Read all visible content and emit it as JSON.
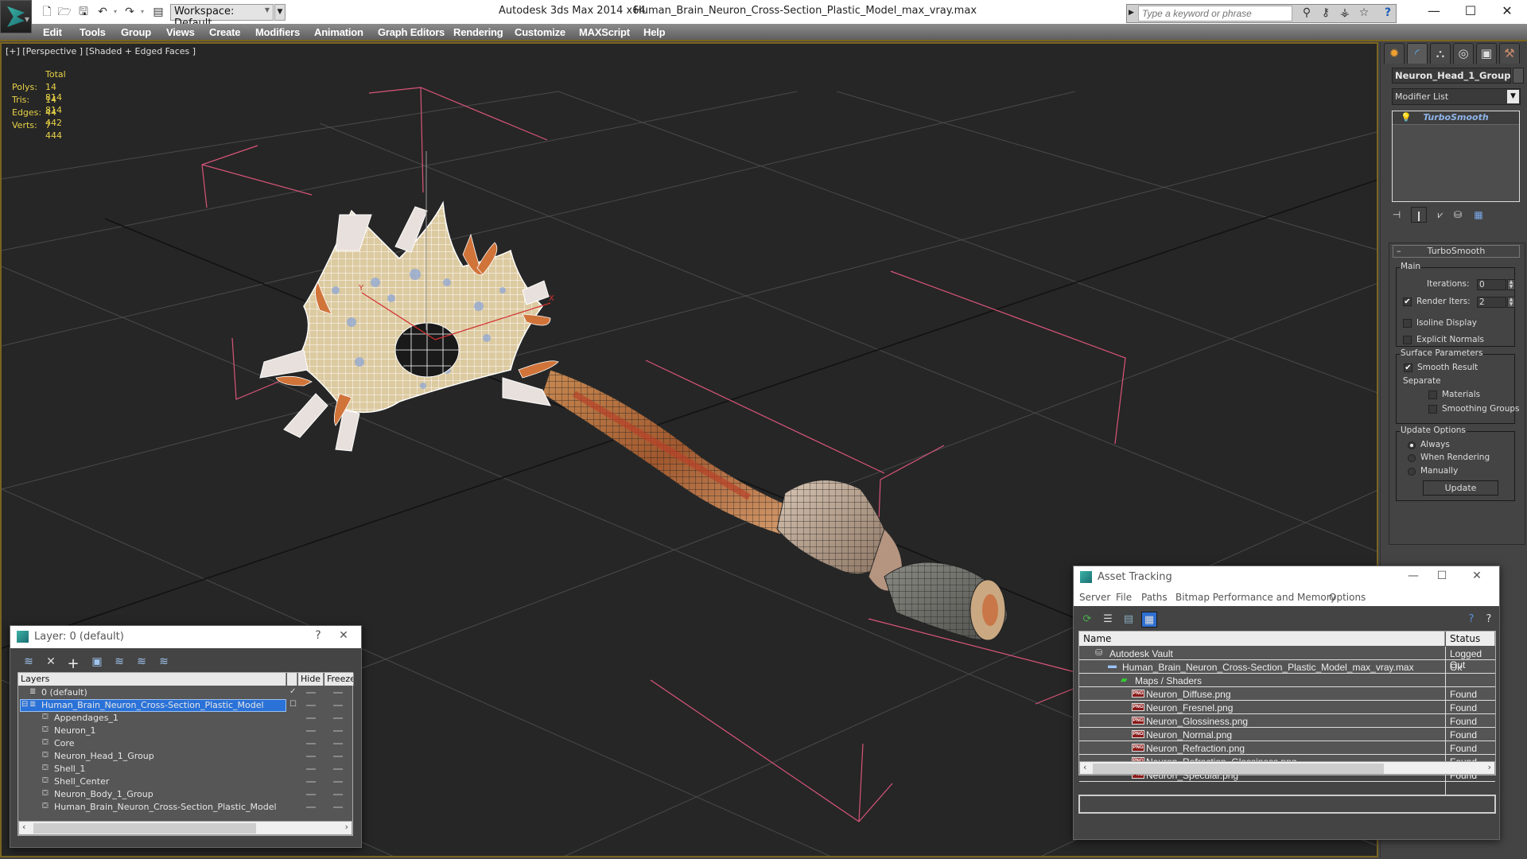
{
  "titlebar": {
    "app_title": "Autodesk 3ds Max  2014 x64",
    "file_title": "Human_Brain_Neuron_Cross-Section_Plastic_Model_max_vray.max",
    "workspace": "Workspace: Default",
    "search_placeholder": "Type a keyword or phrase",
    "quick_access": [
      "new-file",
      "open-file",
      "save-file",
      "undo",
      "redo",
      "project-folder"
    ],
    "info_icons": [
      "binoculars",
      "key",
      "satellite",
      "star",
      "help"
    ]
  },
  "menu": [
    "Edit",
    "Tools",
    "Group",
    "Views",
    "Create",
    "Modifiers",
    "Animation",
    "Graph Editors",
    "Rendering",
    "Customize",
    "MAXScript",
    "Help"
  ],
  "viewport": {
    "label": "[+] [Perspective ] [Shaded + Edged Faces ]",
    "stats": {
      "header": "Total",
      "rows": [
        {
          "label": "Polys:",
          "value": "14 814"
        },
        {
          "label": "Tris:",
          "value": "14 814"
        },
        {
          "label": "Edges:",
          "value": "44 442"
        },
        {
          "label": "Verts:",
          "value": "7 444"
        }
      ]
    },
    "axis_x_label": "X",
    "axis_y_label": "Y"
  },
  "command_panel": {
    "tabs": [
      "create",
      "modify",
      "hierarchy",
      "motion",
      "display",
      "utilities"
    ],
    "active_tab": "modify",
    "object_name": "Neuron_Head_1_Group",
    "modifier_list": "Modifier List",
    "stack": [
      "TurboSmooth"
    ],
    "rollout": {
      "title": "TurboSmooth",
      "main_group": "Main",
      "iterations_label": "Iterations:",
      "iterations_value": "0",
      "render_iters_label": "Render Iters:",
      "render_iters_value": "2",
      "render_iters_checked": true,
      "isoline_label": "Isoline Display",
      "isoline_checked": false,
      "explicit_normals_label": "Explicit Normals",
      "explicit_normals_checked": false,
      "surface_group": "Surface Parameters",
      "smooth_result_label": "Smooth Result",
      "smooth_result_checked": true,
      "separate_label": "Separate",
      "materials_label": "Materials",
      "smoothing_groups_label": "Smoothing Groups",
      "update_group": "Update Options",
      "update_options": [
        "Always",
        "When Rendering",
        "Manually"
      ],
      "update_selected": "Always",
      "update_button": "Update"
    }
  },
  "layer_window": {
    "title": "Layer: 0 (default)",
    "help": "?",
    "close": "✕",
    "columns": [
      "Layers",
      "Hide",
      "Freeze"
    ],
    "layers": [
      {
        "name": "0 (default)",
        "type": "layer",
        "current": true,
        "selected": false,
        "indent": 0
      },
      {
        "name": "Human_Brain_Neuron_Cross-Section_Plastic_Model",
        "type": "layer",
        "current": false,
        "selected": true,
        "indent": 0,
        "expanded": true
      },
      {
        "name": "Appendages_1",
        "type": "object",
        "indent": 1
      },
      {
        "name": "Neuron_1",
        "type": "object",
        "indent": 1
      },
      {
        "name": "Core",
        "type": "object",
        "indent": 1
      },
      {
        "name": "Neuron_Head_1_Group",
        "type": "object",
        "indent": 1
      },
      {
        "name": "Shell_1",
        "type": "object",
        "indent": 1
      },
      {
        "name": "Shell_Center",
        "type": "object",
        "indent": 1
      },
      {
        "name": "Neuron_Body_1_Group",
        "type": "object",
        "indent": 1
      },
      {
        "name": "Human_Brain_Neuron_Cross-Section_Plastic_Model",
        "type": "object",
        "indent": 1
      }
    ]
  },
  "asset_window": {
    "title": "Asset Tracking",
    "menu": [
      "Server",
      "File",
      "Paths",
      "Bitmap Performance and Memory",
      "Options"
    ],
    "columns": [
      "Name",
      "Status"
    ],
    "rows": [
      {
        "name": "Autodesk Vault",
        "status": "Logged Out",
        "icon": "vault",
        "indent": 0
      },
      {
        "name": "Human_Brain_Neuron_Cross-Section_Plastic_Model_max_vray.max",
        "status": "Ok",
        "icon": "max-file",
        "indent": 1
      },
      {
        "name": "Maps / Shaders",
        "status": "",
        "icon": "maps",
        "indent": 2
      },
      {
        "name": "Neuron_Diffuse.png",
        "status": "Found",
        "icon": "png",
        "indent": 3
      },
      {
        "name": "Neuron_Fresnel.png",
        "status": "Found",
        "icon": "png",
        "indent": 3
      },
      {
        "name": "Neuron_Glossiness.png",
        "status": "Found",
        "icon": "png",
        "indent": 3
      },
      {
        "name": "Neuron_Normal.png",
        "status": "Found",
        "icon": "png",
        "indent": 3
      },
      {
        "name": "Neuron_Refraction.png",
        "status": "Found",
        "icon": "png",
        "indent": 3
      },
      {
        "name": "Neuron_Refraction_Glossiness.png",
        "status": "Found",
        "icon": "png",
        "indent": 3
      },
      {
        "name": "Neuron_Specular.png",
        "status": "Found",
        "icon": "png",
        "indent": 3
      }
    ],
    "path_field": ""
  },
  "colors": {
    "viewport_bg": "#262626",
    "viewport_border": "#7a6420",
    "stats_text": "#e8d247",
    "selection": "#2a72d8",
    "stack_item_text": "#8fb4e8",
    "gizmo": "#d9557a"
  }
}
